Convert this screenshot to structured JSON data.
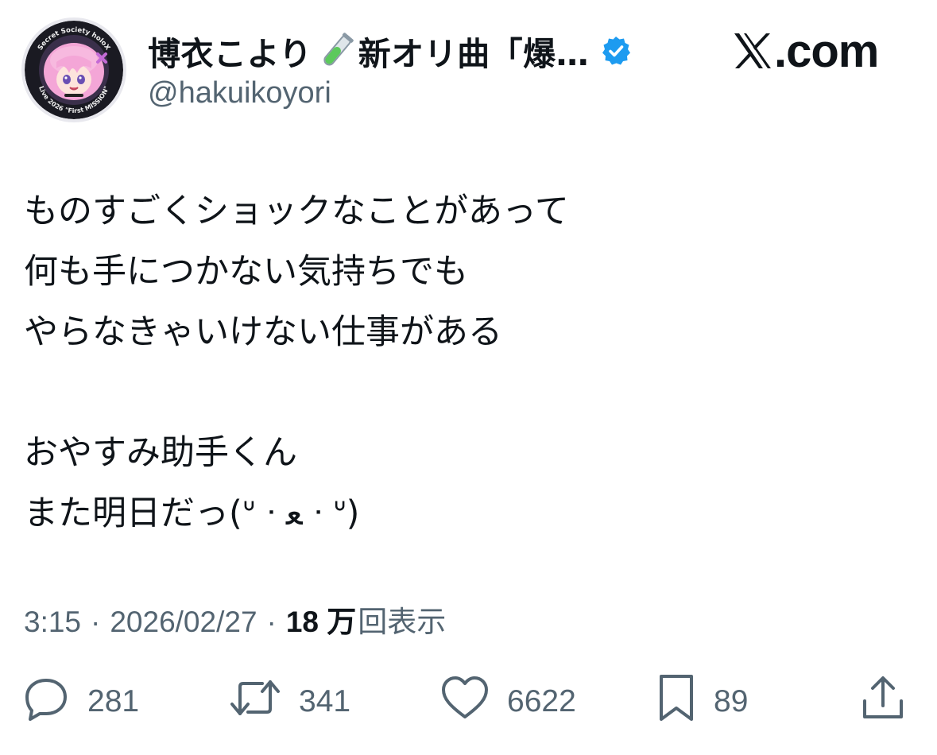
{
  "account": {
    "display_name": "博衣こより",
    "name_suffix": "新オリ曲「爆…",
    "handle": "@hakuikoyori",
    "avatar_ring_text_top": "Secret Society holoX",
    "avatar_ring_text_bottom": "Live 2026 \"First MISSION\""
  },
  "brand": {
    "label": ".com"
  },
  "tweet": {
    "text": "ものすごくショックなことがあって\n何も手につかない気持ちでも\nやらなきゃいけない仕事がある\n\nおやすみ助手くん\nまた明日だっ(ᐡ ᐧ ﻌ ᐧ ᐡ)"
  },
  "meta": {
    "time": "3:15",
    "date": "2026/02/27",
    "separator": "·",
    "views_count": "18 万",
    "views_label": "回表示"
  },
  "actions": {
    "replies": "281",
    "reposts": "341",
    "likes": "6622",
    "bookmarks": "89"
  },
  "colors": {
    "text_primary": "#0f1419",
    "text_secondary": "#536471",
    "verified_badge": "#1d9bf0",
    "tube_green": "#5cc95c",
    "avatar_hair": "#f4a6d7"
  }
}
